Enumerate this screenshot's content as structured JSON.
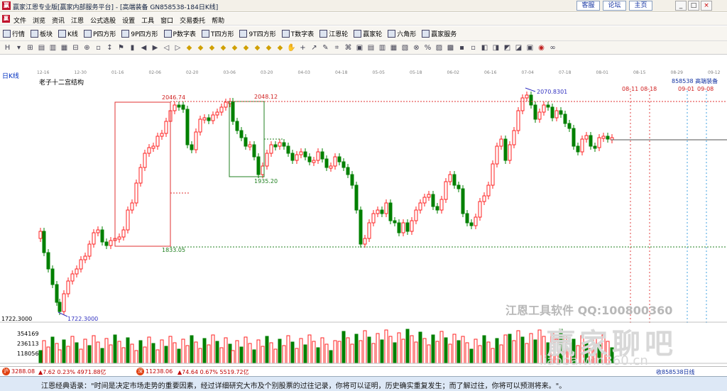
{
  "window": {
    "title": "赢家江恩专业版[赢家内部服务平台] - [高端装备  GN858538-184日K线]",
    "links": [
      "客服",
      "论坛",
      "主页"
    ],
    "controls": [
      "_",
      "□",
      "×"
    ],
    "mdi_controls": [
      "_",
      "▫",
      "×"
    ],
    "icon_text": "赢"
  },
  "menu": {
    "icon_text": "赢",
    "items": [
      "文件",
      "浏览",
      "资讯",
      "江恩",
      "公式选股",
      "设置",
      "工具",
      "窗口",
      "交易委托",
      "帮助"
    ]
  },
  "funcbar": {
    "items": [
      {
        "icon": "bars-icon",
        "label": "行情"
      },
      {
        "icon": "grid-icon",
        "label": "板块"
      },
      {
        "icon": "candle-icon",
        "label": "K线"
      },
      {
        "icon": "p-square-icon",
        "label": "P四方形"
      },
      {
        "icon": "9p-square-icon",
        "label": "9P四方形"
      },
      {
        "icon": "pn-icon",
        "label": "P数字表"
      },
      {
        "icon": "t-square-icon",
        "label": "T四方形"
      },
      {
        "icon": "9t-square-icon",
        "label": "9T四方形"
      },
      {
        "icon": "tn-icon",
        "label": "T数字表"
      },
      {
        "icon": "wheel-icon",
        "label": "江恩轮"
      },
      {
        "icon": "winner-wheel-icon",
        "label": "赢家轮"
      },
      {
        "icon": "hexagon-icon",
        "label": "六角形"
      },
      {
        "icon": "dollar-icon",
        "label": "赢家服务"
      }
    ]
  },
  "toolbar": {
    "icons": [
      "H",
      "▾",
      "⊞",
      "▤",
      "▥",
      "▦",
      "⊟",
      "⊕",
      "▫",
      "↕",
      "⚑",
      "▮",
      "◀",
      "▶",
      "◁",
      "▷",
      "◆",
      "◆",
      "◆",
      "◆",
      "◆",
      "◆",
      "◆",
      "◆",
      "◆",
      "✋",
      "+",
      "↗",
      "✎",
      "⌗",
      "⌘",
      "▣",
      "▤",
      "▥",
      "▦",
      "▧",
      "⊗",
      "%",
      "▨",
      "▩",
      "▪",
      "▫",
      "◧",
      "◨",
      "◩",
      "◪",
      "▣",
      "◉",
      "∞"
    ]
  },
  "chart": {
    "label": "日K线",
    "indicator": "老子十二宫结构",
    "code_label": "858538  高端装备",
    "dates": [
      "12-16",
      "12-30",
      "01-16",
      "02-06",
      "02-20",
      "03-06",
      "03-20",
      "04-03",
      "04-18",
      "05-05",
      "05-18",
      "06-02",
      "06-16",
      "07-04",
      "07-18",
      "08-01",
      "08-15",
      "08-29",
      "09-12"
    ],
    "price_labels": {
      "a": "2046.74",
      "b": "2048.12",
      "c": "1935.20",
      "d": "1833.05",
      "e": "1722.3000",
      "f": "2070.8301"
    },
    "left_axis": {
      "price": "1722.3000",
      "vol": [
        "354169",
        "236113",
        "118056"
      ]
    },
    "future_dates": [
      "08-11",
      "08-18",
      "09-01",
      "09-08"
    ],
    "watermark_tools": "江恩工具软件    QQ:100800360",
    "watermark_big": "赢家聊吧",
    "watermark_url": "liaoba.win360.cn",
    "colors": {
      "up": "#ff2020",
      "down": "#008000",
      "box_red": "#e03030",
      "box_green": "#208020",
      "axis": "#3030c0"
    }
  },
  "status": {
    "sh": {
      "icon": "沪",
      "value": "3288.08",
      "change": "▲7.62  0.23%  4971.88亿"
    },
    "sz": {
      "icon": "深",
      "value": "11238.06",
      "change": "▲74.64  0.67%  5519.72亿"
    },
    "right": "收858538日线"
  },
  "quote": "江恩经典语录：\"时间是决定市场走势的重要因素，经过详细研究大市及个别股票的过往记录，你将可以证明，历史确实重复发生；而了解过往，你将可以预测将来。\"。"
}
